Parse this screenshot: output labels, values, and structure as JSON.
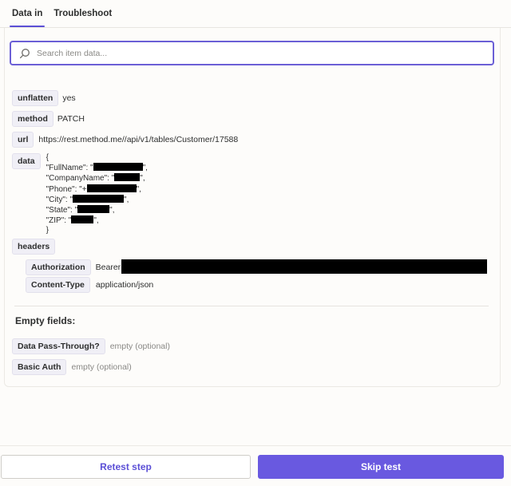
{
  "tabs": [
    {
      "label": "Data in"
    },
    {
      "label": "Troubleshoot"
    }
  ],
  "search": {
    "placeholder": "Search item data..."
  },
  "fields": {
    "unflatten": {
      "key": "unflatten",
      "value": "yes"
    },
    "method": {
      "key": "method",
      "value": "PATCH"
    },
    "url": {
      "key": "url",
      "value": "https://rest.method.me//api/v1/tables/Customer/17588"
    },
    "data": {
      "key": "data",
      "open": "{",
      "close": "}",
      "lines": [
        {
          "pre": "\"FullName\": \"",
          "post": "\","
        },
        {
          "pre": "\"CompanyName\": \"",
          "post": "\","
        },
        {
          "pre": "\"Phone\": \"+",
          "post": "\","
        },
        {
          "pre": "\"City\": \"",
          "post": "\","
        },
        {
          "pre": "\"State\": \"",
          "post": "\","
        },
        {
          "pre": "\"ZIP\": \"",
          "post": "\","
        }
      ]
    },
    "headers": {
      "key": "headers",
      "authorization": {
        "key": "Authorization",
        "value": "Bearer N"
      },
      "content_type": {
        "key": "Content-Type",
        "value": "application/json"
      }
    }
  },
  "empty": {
    "title": "Empty fields:",
    "data_pass_through": {
      "key": "Data Pass-Through?",
      "value": "empty (optional)"
    },
    "basic_auth": {
      "key": "Basic Auth",
      "value": "empty (optional)"
    }
  },
  "footer": {
    "retest_label": "Retest step",
    "skip_label": "Skip test"
  },
  "colors": {
    "accent": "#6959e0",
    "redaction": "#000000"
  }
}
